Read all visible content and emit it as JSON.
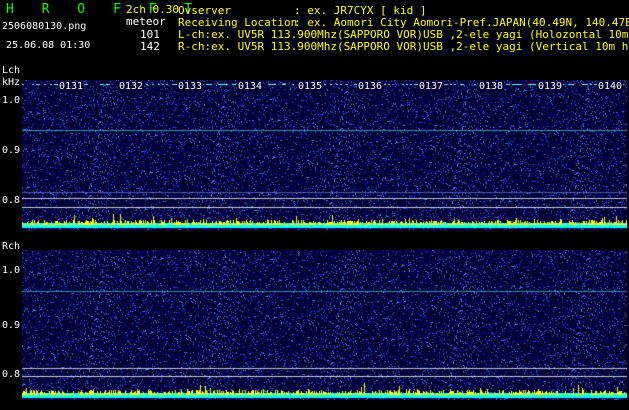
{
  "header": {
    "title": "H R O F F T",
    "mode": "2ch 0.30",
    "filename": "2506080130.png",
    "meteor_label": "meteor",
    "datetime": "25.06.08 01:30",
    "count_lch": "101",
    "count_rch": "142"
  },
  "info": {
    "observer_key": "Ovserver",
    "observer_val": ": ex. JR7CYX [ kid ]",
    "location_key": "Receiving Location",
    "location_val": ": ex. Aomori City Aomori-Pref.JAPAN(40.49N, 140.47E)",
    "lch_line": "L-ch:ex. UV5R 113.900Mhz(SAPPORO VOR)USB ,2-ele yagi (Holozontal 10m height)",
    "rch_line": "R-ch:ex. UV5R 113.900Mhz(SAPPORO VOR)USB ,2-ele yagi (Vertical 10m height)"
  },
  "lch": {
    "label": "Lch",
    "unit": "kHz",
    "y_ticks": [
      "1.0",
      "0.9",
      "0.8"
    ]
  },
  "rch": {
    "label": "Rch",
    "y_ticks": [
      "1.0",
      "0.9",
      "0.8"
    ]
  },
  "time_ticks": [
    "0131",
    "0132",
    "0133",
    "0134",
    "0135",
    "0136",
    "0137",
    "0138",
    "0139",
    "0140"
  ],
  "colors": {
    "background": "#000000",
    "waterfall_base": "#00003a",
    "echo_line": "#66ffff",
    "bar_yellow": "#ffff00",
    "bar_cyan": "#00ffff"
  }
}
